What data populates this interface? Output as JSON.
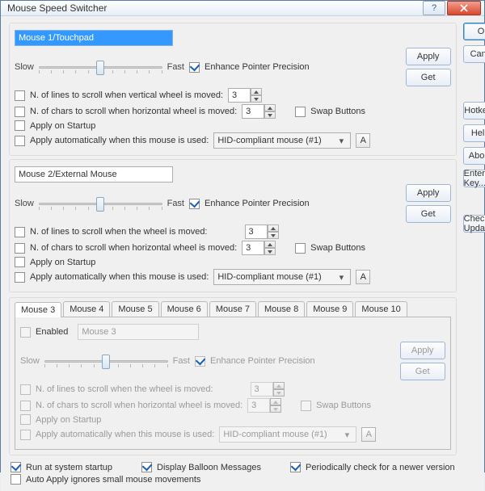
{
  "window": {
    "title": "Mouse Speed Switcher"
  },
  "side": {
    "ok": "OK",
    "cancel": "Cancel",
    "hotkeys": "Hotkeys...",
    "help": "Help...",
    "about": "About...",
    "enterkey": "Enter Key...",
    "checkupd": "Check Updates..."
  },
  "common": {
    "slow": "Slow",
    "fast": "Fast",
    "epp": "Enhance Pointer Precision",
    "apply": "Apply",
    "get": "Get",
    "lines_v": "N. of lines to scroll when vertical wheel is moved:",
    "lines": "N. of lines to scroll when the wheel is moved:",
    "chars": "N. of chars to scroll when  horizontal wheel is moved:",
    "swap": "Swap Buttons",
    "aos": "Apply on Startup",
    "auto": "Apply automatically when this mouse is used:",
    "device": "HID-compliant mouse (#1)",
    "abtn": "A",
    "enabled": "Enabled"
  },
  "m1": {
    "name": "Mouse 1/Touchpad",
    "lines": "3",
    "chars": "3",
    "epp": true
  },
  "m2": {
    "name": "Mouse 2/External Mouse",
    "lines": "3",
    "chars": "3",
    "epp": true
  },
  "m3": {
    "name": "Mouse 3",
    "lines": "3",
    "chars": "3",
    "epp": true
  },
  "tabs": [
    "Mouse 3",
    "Mouse 4",
    "Mouse 5",
    "Mouse 6",
    "Mouse 7",
    "Mouse 8",
    "Mouse 9",
    "Mouse 10"
  ],
  "footer": {
    "run": "Run at system startup",
    "balloon": "Display Balloon Messages",
    "periodic": "Periodically check for a newer version",
    "autoapply": "Auto Apply ignores small mouse movements",
    "run_on": true,
    "balloon_on": true,
    "periodic_on": true,
    "autoapply_on": false
  }
}
